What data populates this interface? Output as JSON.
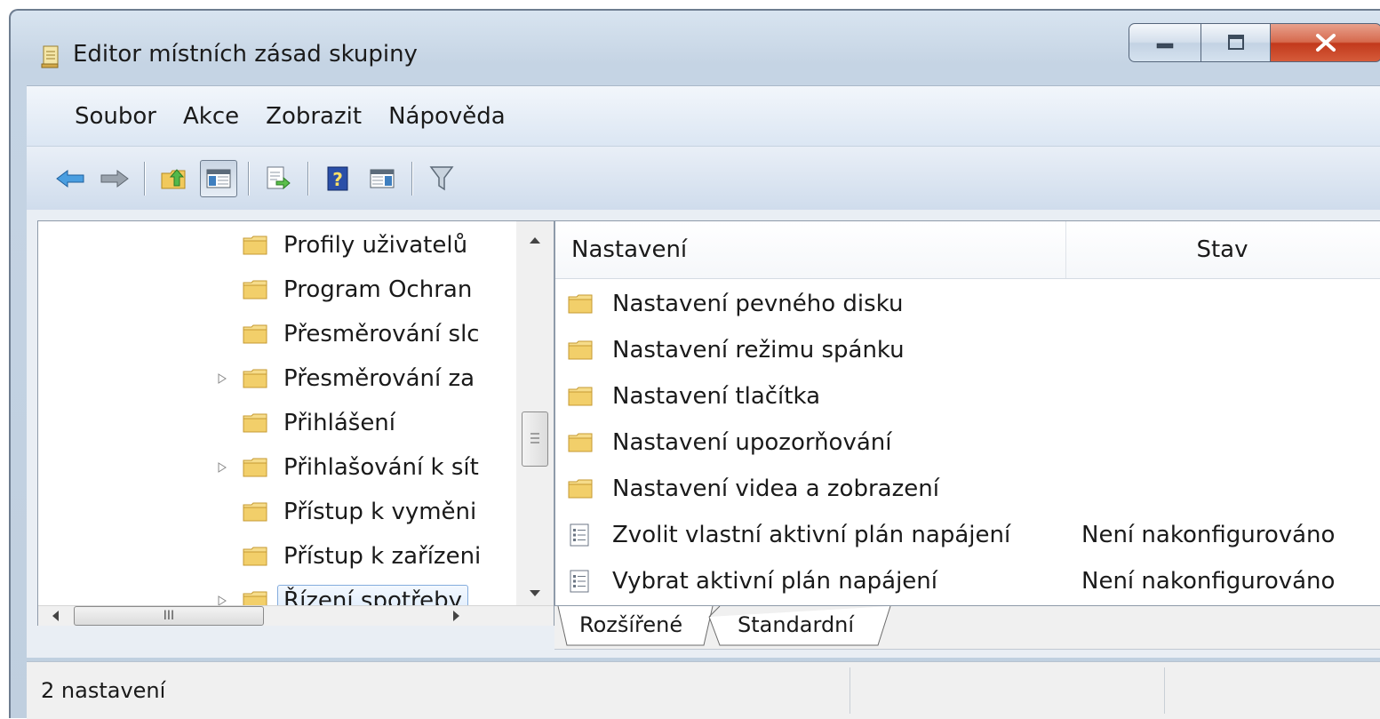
{
  "window": {
    "title": "Editor místních zásad skupiny"
  },
  "menu": {
    "items": [
      "Soubor",
      "Akce",
      "Zobrazit",
      "Nápověda"
    ]
  },
  "toolbar": {
    "buttons": [
      "back-arrow-icon",
      "forward-arrow-icon",
      "up-folder-icon",
      "show-hide-tree-icon",
      "export-list-icon",
      "help-icon",
      "show-action-pane-icon",
      "filter-icon"
    ]
  },
  "tree": {
    "items": [
      {
        "label": "Profily uživatelů"
      },
      {
        "label": "Program Ochran"
      },
      {
        "label": "Přesměrování slc"
      },
      {
        "label": "Přesměrování za"
      },
      {
        "label": "Přihlášení"
      },
      {
        "label": "Přihlašování k sít"
      },
      {
        "label": "Přístup k vyměni"
      },
      {
        "label": "Přístup k zařízeni"
      },
      {
        "label": "Řízení spotřeby"
      }
    ],
    "hscroll_grip": "III"
  },
  "list": {
    "columns": {
      "name": "Nastavení",
      "state": "Stav"
    },
    "rows": [
      {
        "name": "Nastavení pevného disku",
        "state": "",
        "icon": "folder-icon"
      },
      {
        "name": "Nastavení režimu spánku",
        "state": "",
        "icon": "folder-icon"
      },
      {
        "name": "Nastavení tlačítka",
        "state": "",
        "icon": "folder-icon"
      },
      {
        "name": "Nastavení upozorňování",
        "state": "",
        "icon": "folder-icon"
      },
      {
        "name": "Nastavení videa a zobrazení",
        "state": "",
        "icon": "folder-icon"
      },
      {
        "name": "Zvolit vlastní aktivní plán napájení",
        "state": "Není nakonfigurováno",
        "icon": "policy-setting-icon"
      },
      {
        "name": "Vybrat aktivní plán napájení",
        "state": "Není nakonfigurováno",
        "icon": "policy-setting-icon"
      }
    ]
  },
  "tabs": {
    "extended": "Rozšířené",
    "standard": "Standardní"
  },
  "status": {
    "text": "2 nastavení"
  },
  "colors": {
    "selection": "#dcebfc",
    "folder": "#f2cf6a",
    "close": "#c2391c"
  }
}
